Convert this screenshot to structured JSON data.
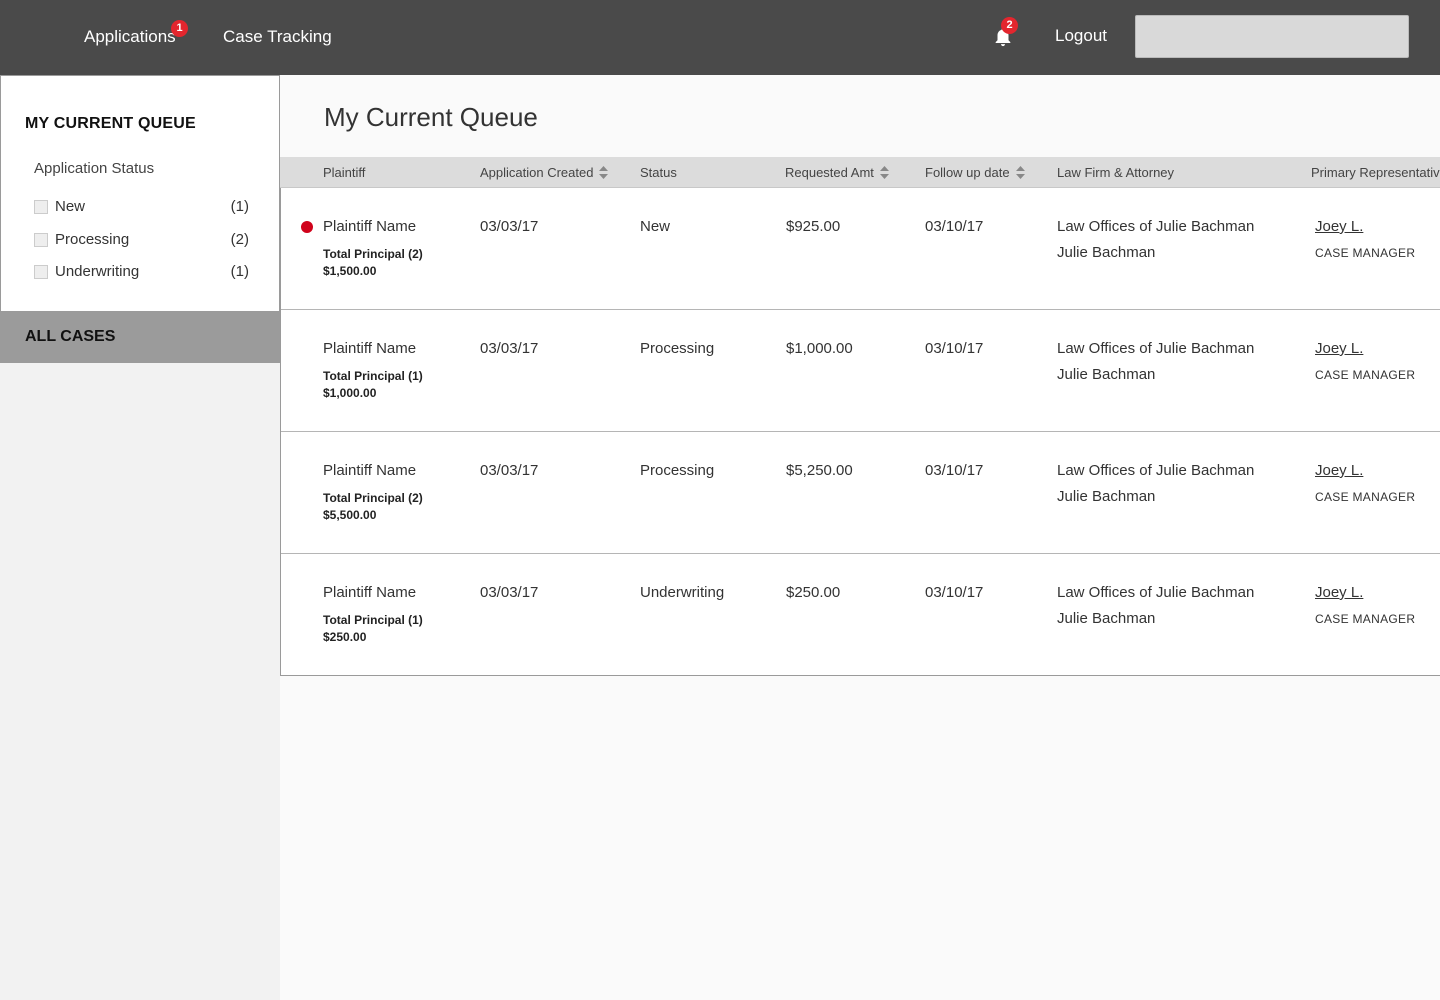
{
  "nav": {
    "applications_label": "Applications",
    "applications_badge": "1",
    "case_tracking_label": "Case Tracking",
    "bell_icon": "bell-icon",
    "notifications_badge": "2",
    "logout_label": "Logout"
  },
  "sidebar": {
    "queue_title": "MY CURRENT QUEUE",
    "status_label": "Application Status",
    "filters": [
      {
        "label": "New",
        "count": "(1)"
      },
      {
        "label": "Processing",
        "count": "(2)"
      },
      {
        "label": "Underwriting",
        "count": "(1)"
      }
    ],
    "all_cases_label": "ALL CASES"
  },
  "main": {
    "title": "My Current Queue",
    "columns": {
      "plaintiff": "Plaintiff",
      "created": "Application Created",
      "status": "Status",
      "requested": "Requested Amt",
      "followup": "Follow up date",
      "lawfirm": "Law Firm & Attorney",
      "rep": "Primary Representative"
    },
    "rows": [
      {
        "plaintiff": "Plaintiff Name",
        "principal": "Total Principal (2)",
        "principal_amt": "$1,500.00",
        "created": "03/03/17",
        "status": "New",
        "requested": "$925.00",
        "followup": "03/10/17",
        "firm": "Law Offices of Julie Bachman",
        "attorney": "Julie Bachman",
        "rep": "Joey L.",
        "rep_role": "CASE MANAGER",
        "flagged": true
      },
      {
        "plaintiff": "Plaintiff Name",
        "principal": "Total Principal (1)",
        "principal_amt": "$1,000.00",
        "created": "03/03/17",
        "status": "Processing",
        "requested": "$1,000.00",
        "followup": "03/10/17",
        "firm": "Law Offices of Julie Bachman",
        "attorney": "Julie Bachman",
        "rep": "Joey L.",
        "rep_role": "CASE MANAGER",
        "flagged": false
      },
      {
        "plaintiff": "Plaintiff Name",
        "principal": "Total Principal (2)",
        "principal_amt": "$5,500.00",
        "created": "03/03/17",
        "status": "Processing",
        "requested": "$5,250.00",
        "followup": "03/10/17",
        "firm": "Law Offices of Julie Bachman",
        "attorney": "Julie Bachman",
        "rep": "Joey L.",
        "rep_role": "CASE MANAGER",
        "flagged": false
      },
      {
        "plaintiff": "Plaintiff Name",
        "principal": "Total Principal (1)",
        "principal_amt": "$250.00",
        "created": "03/03/17",
        "status": "Underwriting",
        "requested": "$250.00",
        "followup": "03/10/17",
        "firm": "Law Offices of Julie Bachman",
        "attorney": "Julie Bachman",
        "rep": "Joey L.",
        "rep_role": "CASE MANAGER",
        "flagged": false
      }
    ]
  },
  "colors": {
    "topbar": "#4a4a4a",
    "badge": "#e3262e",
    "flag_dot": "#d0021b",
    "all_cases_bg": "#9b9b9b"
  }
}
